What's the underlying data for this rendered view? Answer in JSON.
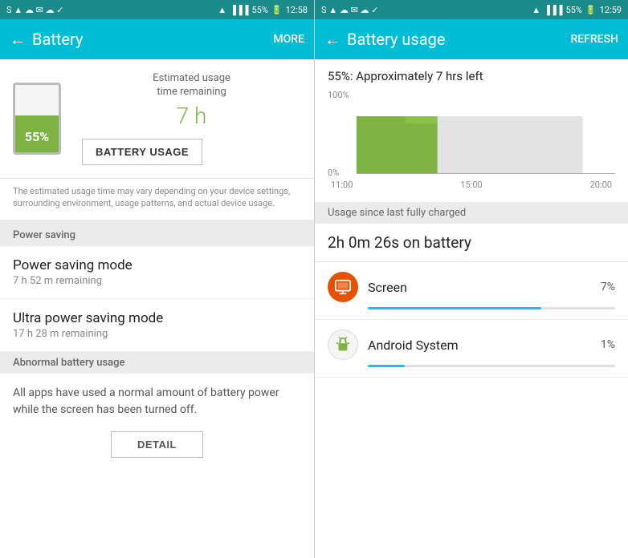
{
  "left": {
    "statusBar": {
      "time": "12:58",
      "battery": "55%",
      "icons": "S ▲ ☁ ✉ ☁ ✓"
    },
    "appBar": {
      "title": "Battery",
      "action": "MORE",
      "backArrow": "←"
    },
    "batterySection": {
      "percent": "55%",
      "estLabel": "Estimated usage\ntime remaining",
      "timeValue": "7 h",
      "usageButtonLabel": "BATTERY USAGE"
    },
    "batteryNote": "The estimated usage time may vary depending on your device settings, surrounding environment, usage patterns, and actual device usage.",
    "powerSavingHeader": "Power saving",
    "powerSavingMode": {
      "title": "Power saving mode",
      "subtitle": "7 h 52 m remaining"
    },
    "ultraPowerSavingMode": {
      "title": "Ultra power saving mode",
      "subtitle": "17 h 28 m remaining"
    },
    "abnormalHeader": "Abnormal battery usage",
    "abnormalText": "All apps have used a normal amount of battery power while the screen has been turned off.",
    "detailButtonLabel": "DETAIL"
  },
  "right": {
    "statusBar": {
      "time": "12:59",
      "battery": "55%",
      "icons": "S ▲ ☁ ✉ ☁ ✓"
    },
    "appBar": {
      "title": "Battery usage",
      "action": "REFRESH",
      "backArrow": "←"
    },
    "usageSummary": "55%: Approximately 7 hrs left",
    "chart": {
      "yLabels": [
        "100%",
        "0%"
      ],
      "xLabels": [
        "11:00",
        "15:00",
        "20:00"
      ]
    },
    "usageSinceLabel": "Usage since last fully charged",
    "usageDuration": "2h 0m 26s on battery",
    "apps": [
      {
        "name": "Screen",
        "percent": "7%",
        "percentValue": 7,
        "iconColor": "#e65100",
        "iconType": "screen"
      },
      {
        "name": "Android System",
        "percent": "1%",
        "percentValue": 1,
        "iconColor": "#f5f5f5",
        "iconType": "android"
      }
    ]
  }
}
